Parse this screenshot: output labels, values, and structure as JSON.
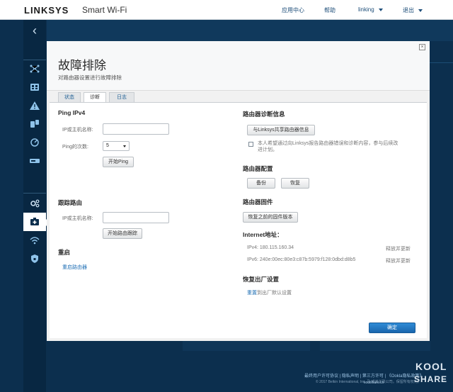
{
  "header": {
    "brand": "LINKSYS",
    "product": "Smart Wi-Fi",
    "nav": {
      "app_center": "应用中心",
      "help": "帮助",
      "user": "linking",
      "logout": "退出"
    }
  },
  "leftnav": {
    "items": [
      {
        "icon": "network-map-icon"
      },
      {
        "icon": "device-list-icon"
      },
      {
        "icon": "alert-icon"
      },
      {
        "icon": "parental-controls-icon"
      },
      {
        "icon": "speed-test-icon"
      },
      {
        "icon": "external-storage-icon"
      },
      {
        "icon": "connectivity-icon"
      },
      {
        "icon": "troubleshooting-icon",
        "active": true
      },
      {
        "icon": "wireless-icon"
      },
      {
        "icon": "security-icon"
      }
    ]
  },
  "panel": {
    "title": "故障排除",
    "subtitle": "对路由器设置进行故障排除",
    "close": "×",
    "tabs": [
      {
        "label": "状态"
      },
      {
        "label": "诊断",
        "active": true
      },
      {
        "label": "日志"
      }
    ],
    "ping": {
      "title": "Ping IPv4",
      "host_label": "IP或主机名称:",
      "host_value": "",
      "count_label": "Ping的次数:",
      "count_value": "5",
      "start_button": "开始Ping"
    },
    "traceroute": {
      "title": "跟踪路由",
      "host_label": "IP或主机名称:",
      "host_value": "",
      "start_button": "开始路由跟踪"
    },
    "reboot": {
      "title": "重启",
      "link": "重启路由器"
    },
    "diagnostics": {
      "title": "路由器诊断信息",
      "share_button": "与Linksys共享路由器信息",
      "consent_text_line1": "本人希望通过向Linksys报告路由器错误和诊断内容，参与后续改",
      "consent_text_line2": "进计划。"
    },
    "config": {
      "title": "路由器配置",
      "backup_button": "备份",
      "restore_button": "恢复"
    },
    "firmware": {
      "title": "路由器固件",
      "restore_button": "恢复之前的固件版本"
    },
    "internet": {
      "title": "Internet地址：",
      "ipv4": "IPv4: 180.115.160.34",
      "ipv4_action": "释放并更新",
      "ipv6": "IPv6: 240e:00ec:80e3:c87b:5979:f128:0dbd:d8b5",
      "ipv6_action": "释放并更新"
    },
    "factory": {
      "title": "恢复出厂设置",
      "link_part": "重置",
      "rest": "到出厂默认设置"
    },
    "ok_button": "确定"
  },
  "footer": {
    "links": [
      "最终用户许可协议",
      "隐私声明",
      "第三方许可",
      "《Ookla隐私政策》"
    ],
    "copyright": "© 2017 Belkin International, Inc. 及/或其关联公司。保留所有权利。",
    "watermark_url": "koolshare.cn",
    "watermark_top": "KOOL",
    "watermark_bottom": "SHARE"
  },
  "colors": {
    "accent": "#1f6fb5",
    "background": "#0c2f4e",
    "primary_button": "#1a66ad"
  }
}
